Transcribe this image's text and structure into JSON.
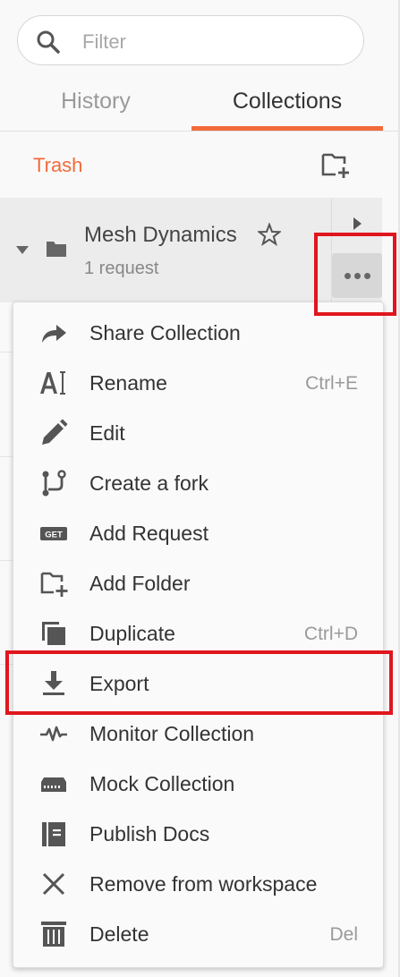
{
  "filter": {
    "placeholder": "Filter"
  },
  "tabs": [
    {
      "label": "History",
      "active": false
    },
    {
      "label": "Collections",
      "active": true
    }
  ],
  "trash": {
    "label": "Trash"
  },
  "collection": {
    "name": "Mesh Dynamics",
    "request_count": "1 request"
  },
  "menu": {
    "items": [
      {
        "label": "Share Collection",
        "icon": "share-icon",
        "shortcut": ""
      },
      {
        "label": "Rename",
        "icon": "rename-icon",
        "shortcut": "Ctrl+E"
      },
      {
        "label": "Edit",
        "icon": "pencil-icon",
        "shortcut": ""
      },
      {
        "label": "Create a fork",
        "icon": "fork-icon",
        "shortcut": ""
      },
      {
        "label": "Add Request",
        "icon": "get-request-icon",
        "icon_text": "GET",
        "shortcut": ""
      },
      {
        "label": "Add Folder",
        "icon": "add-folder-icon",
        "shortcut": ""
      },
      {
        "label": "Duplicate",
        "icon": "duplicate-icon",
        "shortcut": "Ctrl+D"
      },
      {
        "label": "Export",
        "icon": "download-icon",
        "shortcut": ""
      },
      {
        "label": "Monitor Collection",
        "icon": "pulse-icon",
        "shortcut": ""
      },
      {
        "label": "Mock Collection",
        "icon": "server-icon",
        "shortcut": ""
      },
      {
        "label": "Publish Docs",
        "icon": "docs-icon",
        "shortcut": ""
      },
      {
        "label": "Remove from workspace",
        "icon": "close-icon",
        "shortcut": ""
      },
      {
        "label": "Delete",
        "icon": "trash-icon",
        "shortcut": "Del"
      }
    ]
  },
  "colors": {
    "accent": "#f26b3a",
    "highlight": "#e0161e",
    "icon": "#555555"
  }
}
